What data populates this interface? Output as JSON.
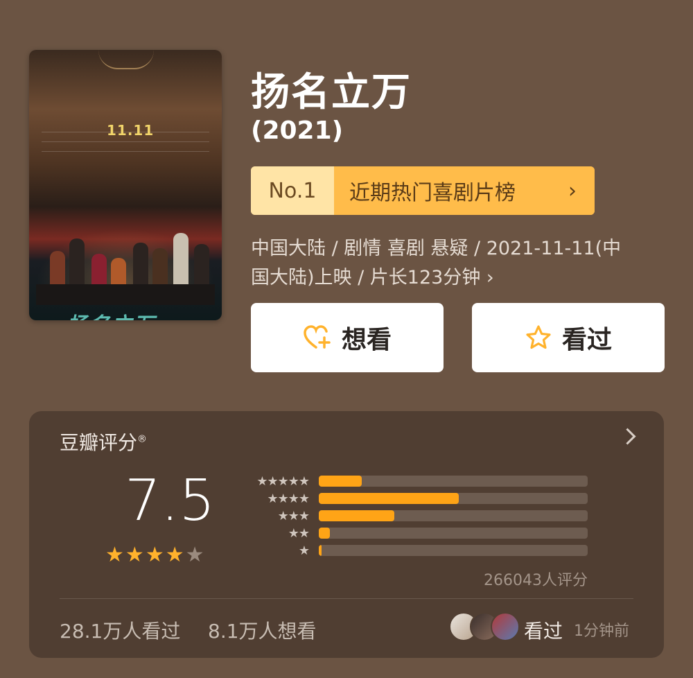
{
  "movie": {
    "title": "扬名立万",
    "year": "(2021)",
    "poster": {
      "date": "11.11",
      "logo_text": "扬名立万"
    },
    "ranking": {
      "number": "No.1",
      "list_name": "近期热门喜剧片榜",
      "chevron": "›"
    },
    "meta_line1": "中国大陆 / 剧情 喜剧 悬疑 / 2021-11-11(中",
    "meta_line2": "国大陆)上映 / 片长123分钟 ›"
  },
  "actions": {
    "want_label": "想看",
    "want_icon": "heart-plus-icon",
    "seen_label": "看过",
    "seen_icon": "star-icon",
    "accent": "#ffb22c"
  },
  "rating": {
    "title": "豆瓣评分",
    "registered": "®",
    "score": "7.5",
    "stars_full": 4,
    "stars_total": 5,
    "distribution": [
      {
        "stars": "★★★★★",
        "fraction": 0.16
      },
      {
        "stars": "★★★★",
        "fraction": 0.52
      },
      {
        "stars": "★★★",
        "fraction": 0.28
      },
      {
        "stars": "★★",
        "fraction": 0.04
      },
      {
        "stars": "★",
        "fraction": 0.01
      }
    ],
    "count": "266043人评分",
    "seen_stat": "28.1万人看过",
    "want_stat": "8.1万人想看",
    "friend_label": "看过",
    "friend_time": "1分钟前",
    "bar_color": "#ffa416"
  }
}
